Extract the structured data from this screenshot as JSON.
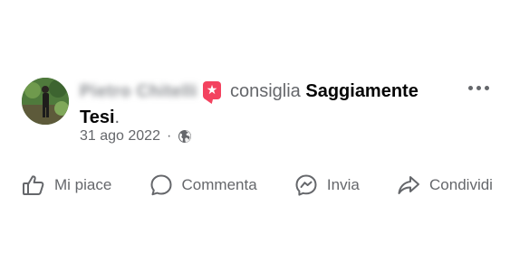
{
  "post": {
    "author_name": "Pietro Chitelli",
    "verb": "consiglia",
    "page_name_part1": "Saggiamente",
    "page_name_part2": "Tesi",
    "period": ".",
    "date": "31 ago 2022",
    "separator": "·",
    "privacy_icon": "globe-icon",
    "recommend_icon": "star-speech-bubble-icon"
  },
  "actions": [
    {
      "label": "Mi piace",
      "icon": "thumbs-up-icon"
    },
    {
      "label": "Commenta",
      "icon": "comment-bubble-icon"
    },
    {
      "label": "Invia",
      "icon": "messenger-icon"
    },
    {
      "label": "Condividi",
      "icon": "share-arrow-icon"
    }
  ],
  "colors": {
    "accent": "#f3425f",
    "secondary_text": "#65676b",
    "primary_text": "#050505"
  }
}
